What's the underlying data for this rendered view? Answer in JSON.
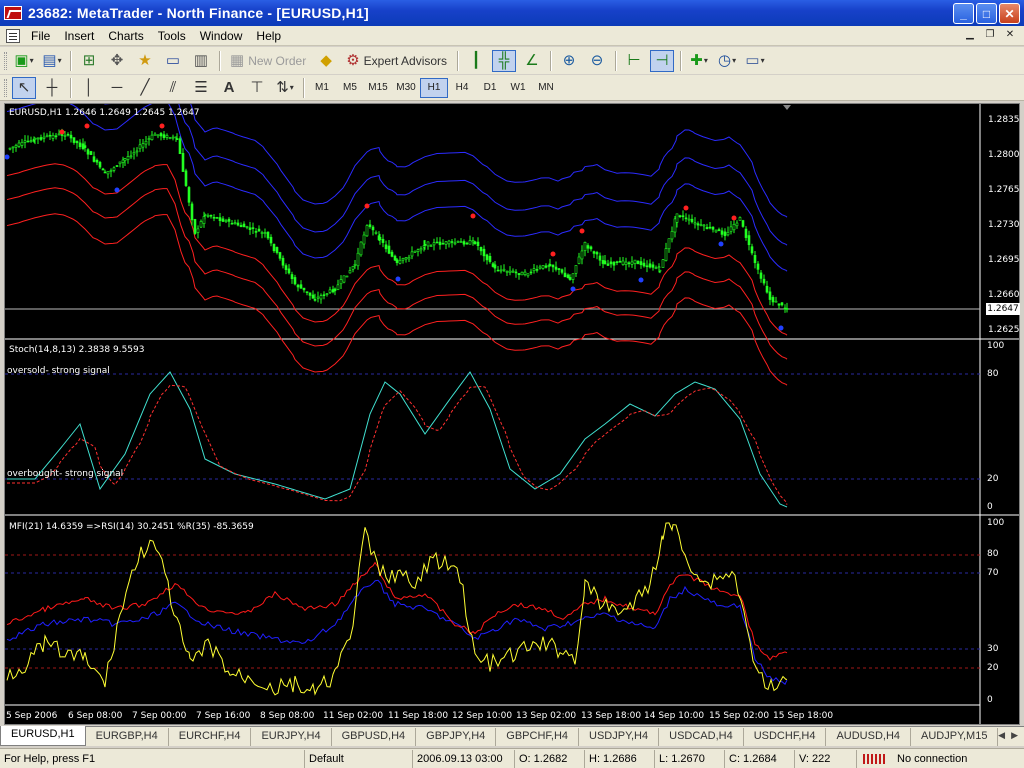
{
  "window": {
    "title": "23682: MetaTrader - North Finance - [EURUSD,H1]",
    "minimize": "_",
    "maximize": "□",
    "close": "✕"
  },
  "menu": [
    "File",
    "Insert",
    "Charts",
    "Tools",
    "Window",
    "Help"
  ],
  "toolbar": {
    "new_order": "New Order",
    "expert_advisors": "Expert Advisors",
    "text_tool": "A",
    "timeframes": [
      "M1",
      "M5",
      "M15",
      "M30",
      "H1",
      "H4",
      "D1",
      "W1",
      "MN"
    ],
    "active_timeframe": "H1"
  },
  "chart": {
    "main_label": "EURUSD,H1  1.2646 1.2649 1.2645 1.2647",
    "price_axis": [
      "1.2835",
      "1.2800",
      "1.2765",
      "1.2730",
      "1.2695",
      "1.2660",
      "1.2625"
    ],
    "current_price": "1.2647",
    "stoch_label": "Stoch(14,8,13) 2.3838 9.5593",
    "stoch_oversold": "oversold-  strong signal",
    "stoch_overbought": "overbought- strong signal",
    "stoch_axis": [
      "100",
      "80",
      "20",
      "0"
    ],
    "mfi_label": "MFI(21) 14.6359  =>RSI(14) 30.2451  %R(35) -85.3659",
    "mfi_axis": [
      "100",
      "80",
      "70",
      "30",
      "20",
      "0"
    ],
    "time_axis": [
      "5 Sep 2006",
      "6 Sep 08:00",
      "7 Sep 00:00",
      "7 Sep 16:00",
      "8 Sep 08:00",
      "11 Sep 02:00",
      "11 Sep 18:00",
      "12 Sep 10:00",
      "13 Sep 02:00",
      "13 Sep 18:00",
      "14 Sep 10:00",
      "15 Sep 02:00",
      "15 Sep 18:00"
    ],
    "colors": {
      "background": "#000000",
      "candles": "#22ff22",
      "upper_bands": "#2b2bff",
      "lower_bands": "#ff2020",
      "stoch_main": "#40e0d0",
      "stoch_signal": "#ff3030",
      "mfi": "#2020ff",
      "rsi": "#ff1a1a",
      "wpr": "#ffff33"
    }
  },
  "tabs": [
    "EURUSD,H1",
    "EURGBP,H4",
    "EURCHF,H4",
    "EURJPY,H4",
    "GBPUSD,H4",
    "GBPJPY,H4",
    "GBPCHF,H4",
    "USDJPY,H4",
    "USDCAD,H4",
    "USDCHF,H4",
    "AUDUSD,H4",
    "AUDJPY,M15"
  ],
  "status": {
    "help": "For Help, press F1",
    "profile": "Default",
    "datetime": "2006.09.13 03:00",
    "open": "O: 1.2682",
    "high": "H: 1.2686",
    "low": "L: 1.2670",
    "close": "C: 1.2684",
    "volume": "V: 222",
    "connection": "No connection"
  }
}
